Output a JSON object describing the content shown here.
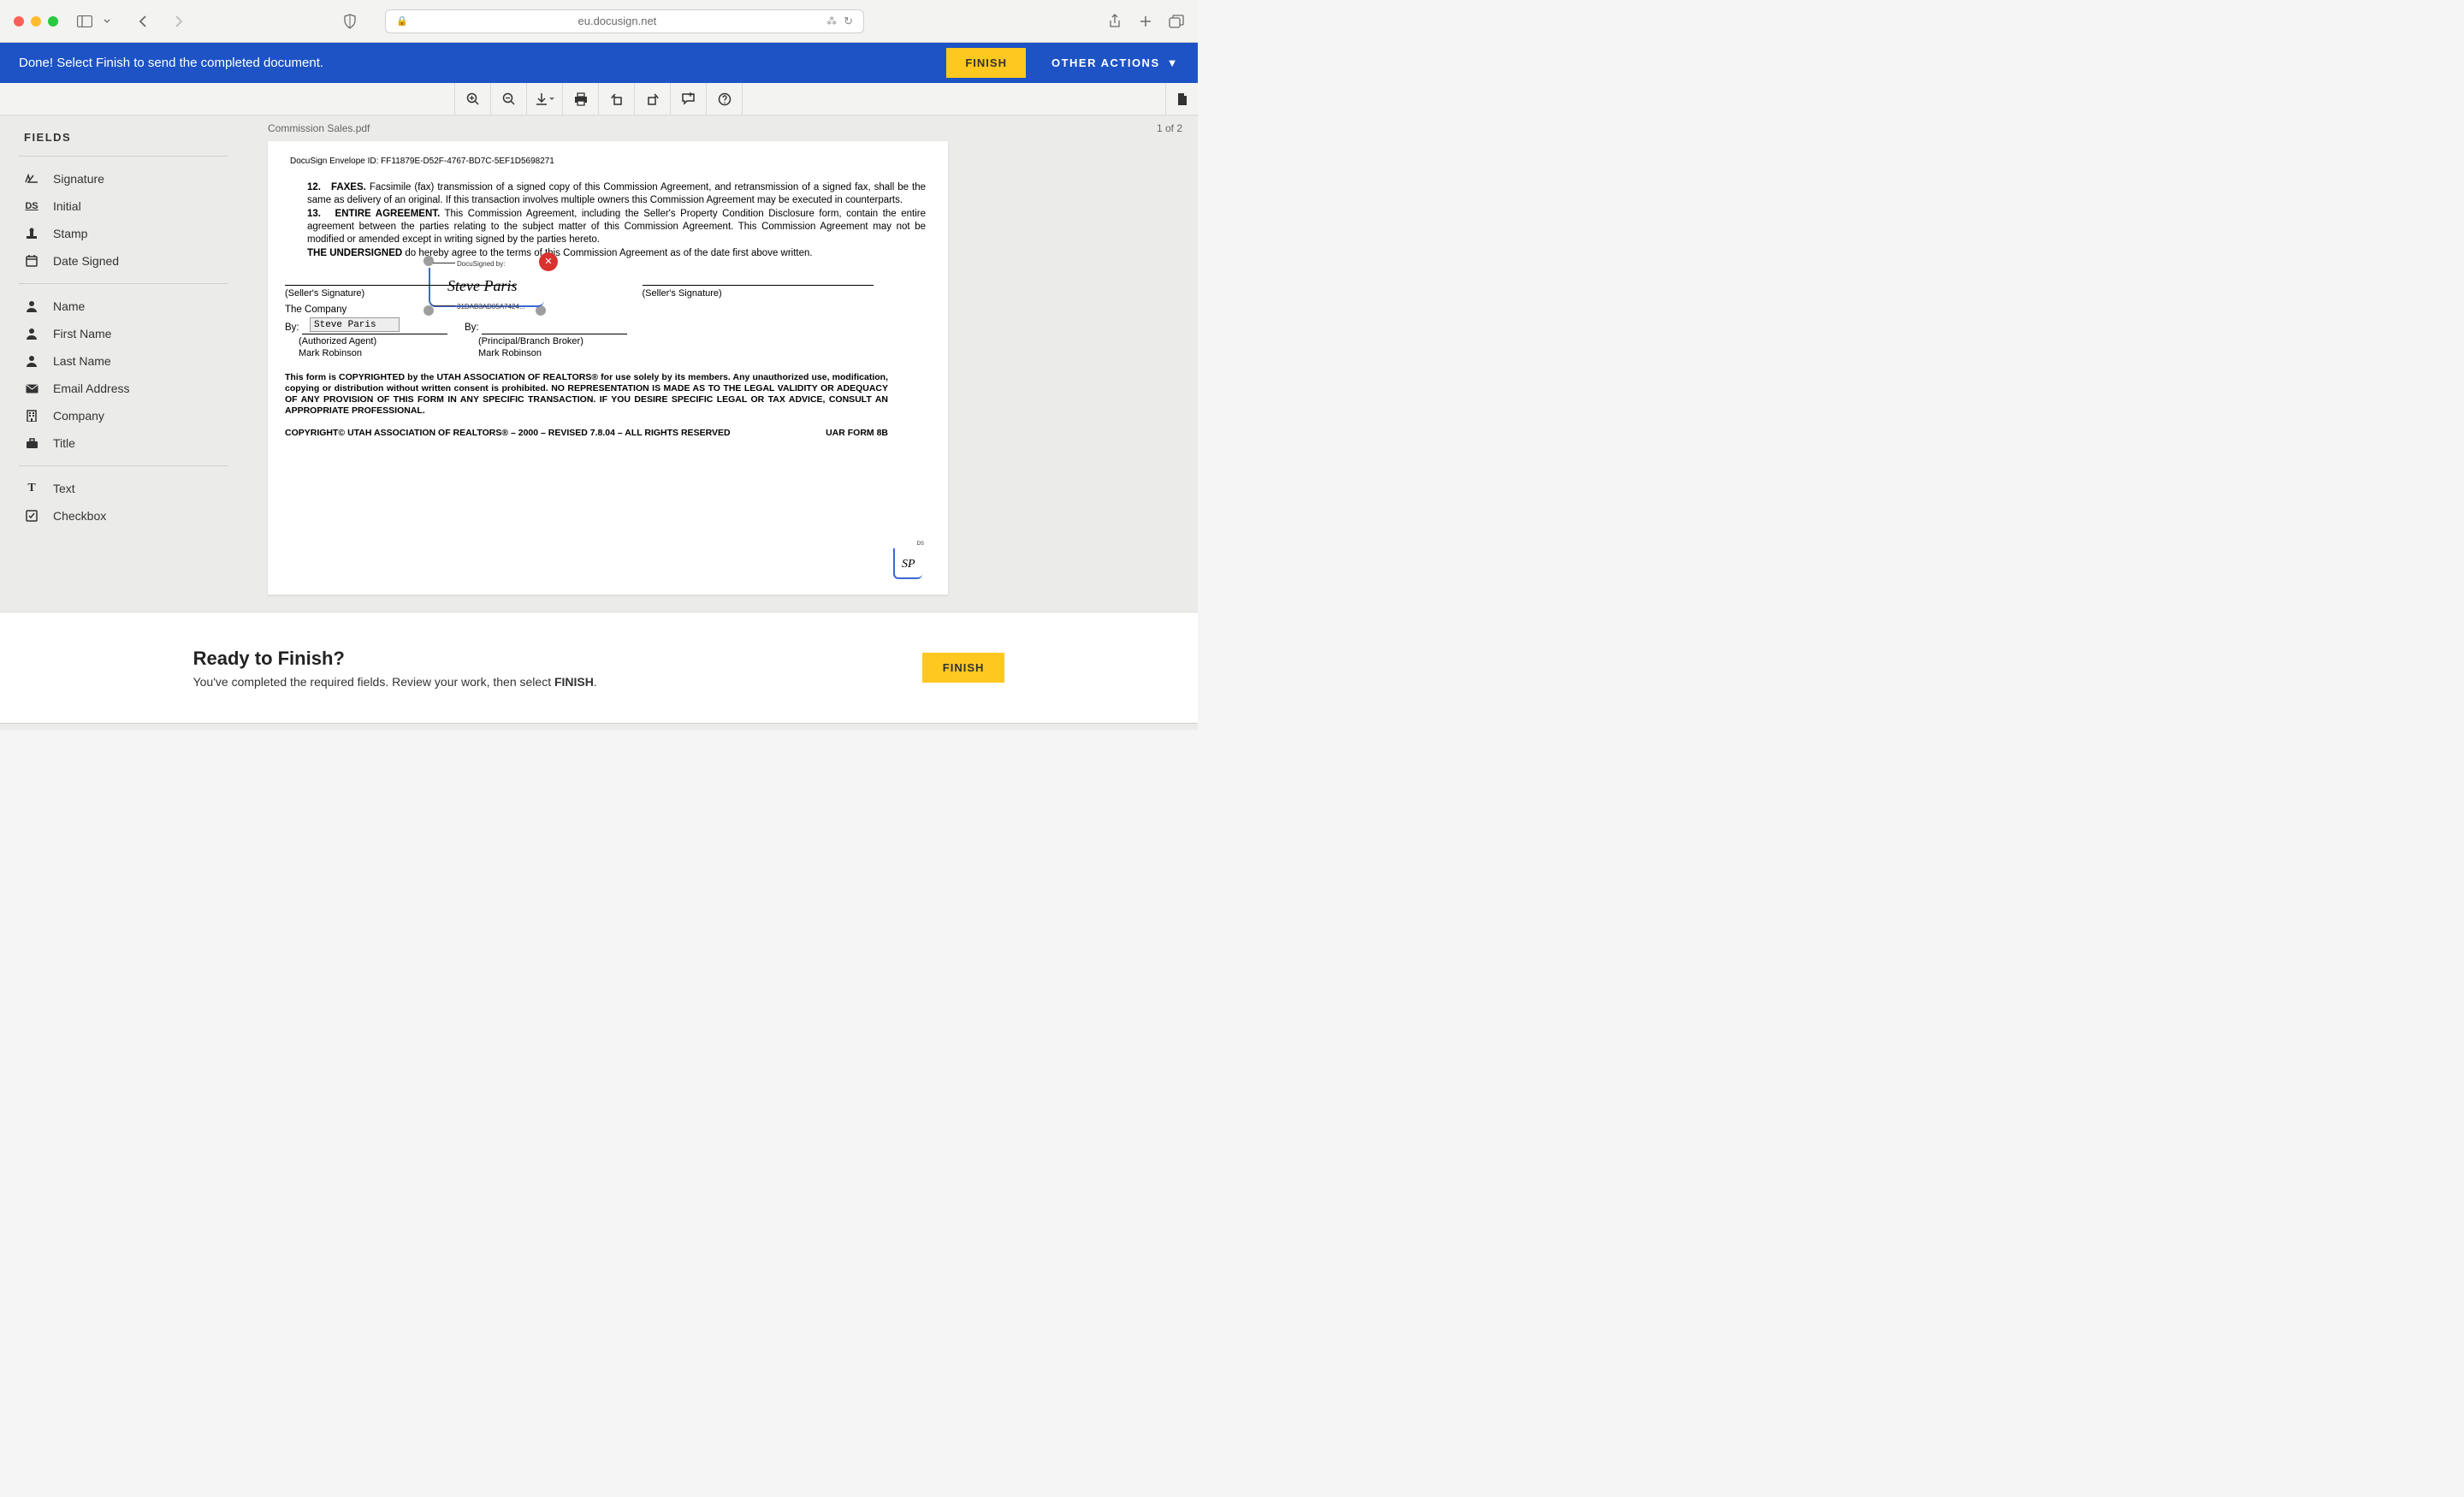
{
  "browser": {
    "url": "eu.docusign.net"
  },
  "action_bar": {
    "message": "Done! Select Finish to send the completed document.",
    "finish_label": "FINISH",
    "other_actions_label": "OTHER ACTIONS"
  },
  "doc_header": {
    "filename": "Commission Sales.pdf",
    "page_indicator": "1 of 2"
  },
  "sidebar": {
    "title": "FIELDS",
    "group1": [
      {
        "label": "Signature"
      },
      {
        "label": "Initial"
      },
      {
        "label": "Stamp"
      },
      {
        "label": "Date Signed"
      }
    ],
    "group2": [
      {
        "label": "Name"
      },
      {
        "label": "First Name"
      },
      {
        "label": "Last Name"
      },
      {
        "label": "Email Address"
      },
      {
        "label": "Company"
      },
      {
        "label": "Title"
      }
    ],
    "group3": [
      {
        "label": "Text"
      },
      {
        "label": "Checkbox"
      }
    ]
  },
  "document": {
    "envelope_id": "DocuSign Envelope ID: FF11879E-D52F-4767-BD7C-5EF1D5698271",
    "para12": "Facsimile (fax) transmission of a signed copy of this Commission Agreement, and retransmission of a signed fax, shall be the same as delivery of an original. If this transaction involves multiple owners this Commission Agreement may be executed in counterparts.",
    "para13": "This Commission Agreement, including the Seller's Property Condition Disclosure form, contain the entire agreement between the parties relating to the subject matter of this Commission Agreement. This Commission Agreement may not be modified or amended except in writing signed by the parties hereto.",
    "undersigned": "do hereby agree to the terms of this Commission Agreement as of the date first above written.",
    "signature": {
      "label": "DocuSigned by:",
      "name": "Steve Paris",
      "hash": "31DAB3AD05A7424..."
    },
    "seller_sig_caption": "(Seller's Signature)",
    "seller_sig_caption2": "(Seller's Signature)",
    "the_company": "The Company",
    "by_label": "By:",
    "by_label2": "By:",
    "typed_name": "Steve Paris",
    "authorized_agent": "(Authorized Agent)",
    "principal_broker": "(Principal/Branch Broker)",
    "mark_robinson": "Mark Robinson",
    "mark_robinson2": "Mark Robinson",
    "copyright_block": "This form is COPYRIGHTED by the UTAH ASSOCIATION OF REALTORS® for use solely by its members. Any unauthorized use, modification, copying or distribution without written consent is prohibited. NO REPRESENTATION IS MADE AS TO THE LEGAL VALIDITY OR ADEQUACY OF ANY PROVISION OF THIS FORM IN ANY SPECIFIC TRANSACTION. IF YOU DESIRE SPECIFIC LEGAL OR TAX ADVICE, CONSULT AN APPROPRIATE PROFESSIONAL.",
    "copyright_line": "COPYRIGHT© UTAH ASSOCIATION OF REALTORS® – 2000 – REVISED 7.8.04 – ALL RIGHTS RESERVED",
    "form_number": "UAR FORM 8B",
    "initials_ds": "DS",
    "initials_text": "SP",
    "section12_num": "12.",
    "section12_title": "FAXES.",
    "section13_num": "13.",
    "section13_title": "ENTIRE AGREEMENT.",
    "undersigned_label": "THE UNDERSIGNED"
  },
  "finish_panel": {
    "heading": "Ready to Finish?",
    "sub_pre": "You've completed the required fields. Review your work, then select ",
    "sub_bold": "FINISH",
    "sub_post": ".",
    "button_label": "FINISH"
  }
}
